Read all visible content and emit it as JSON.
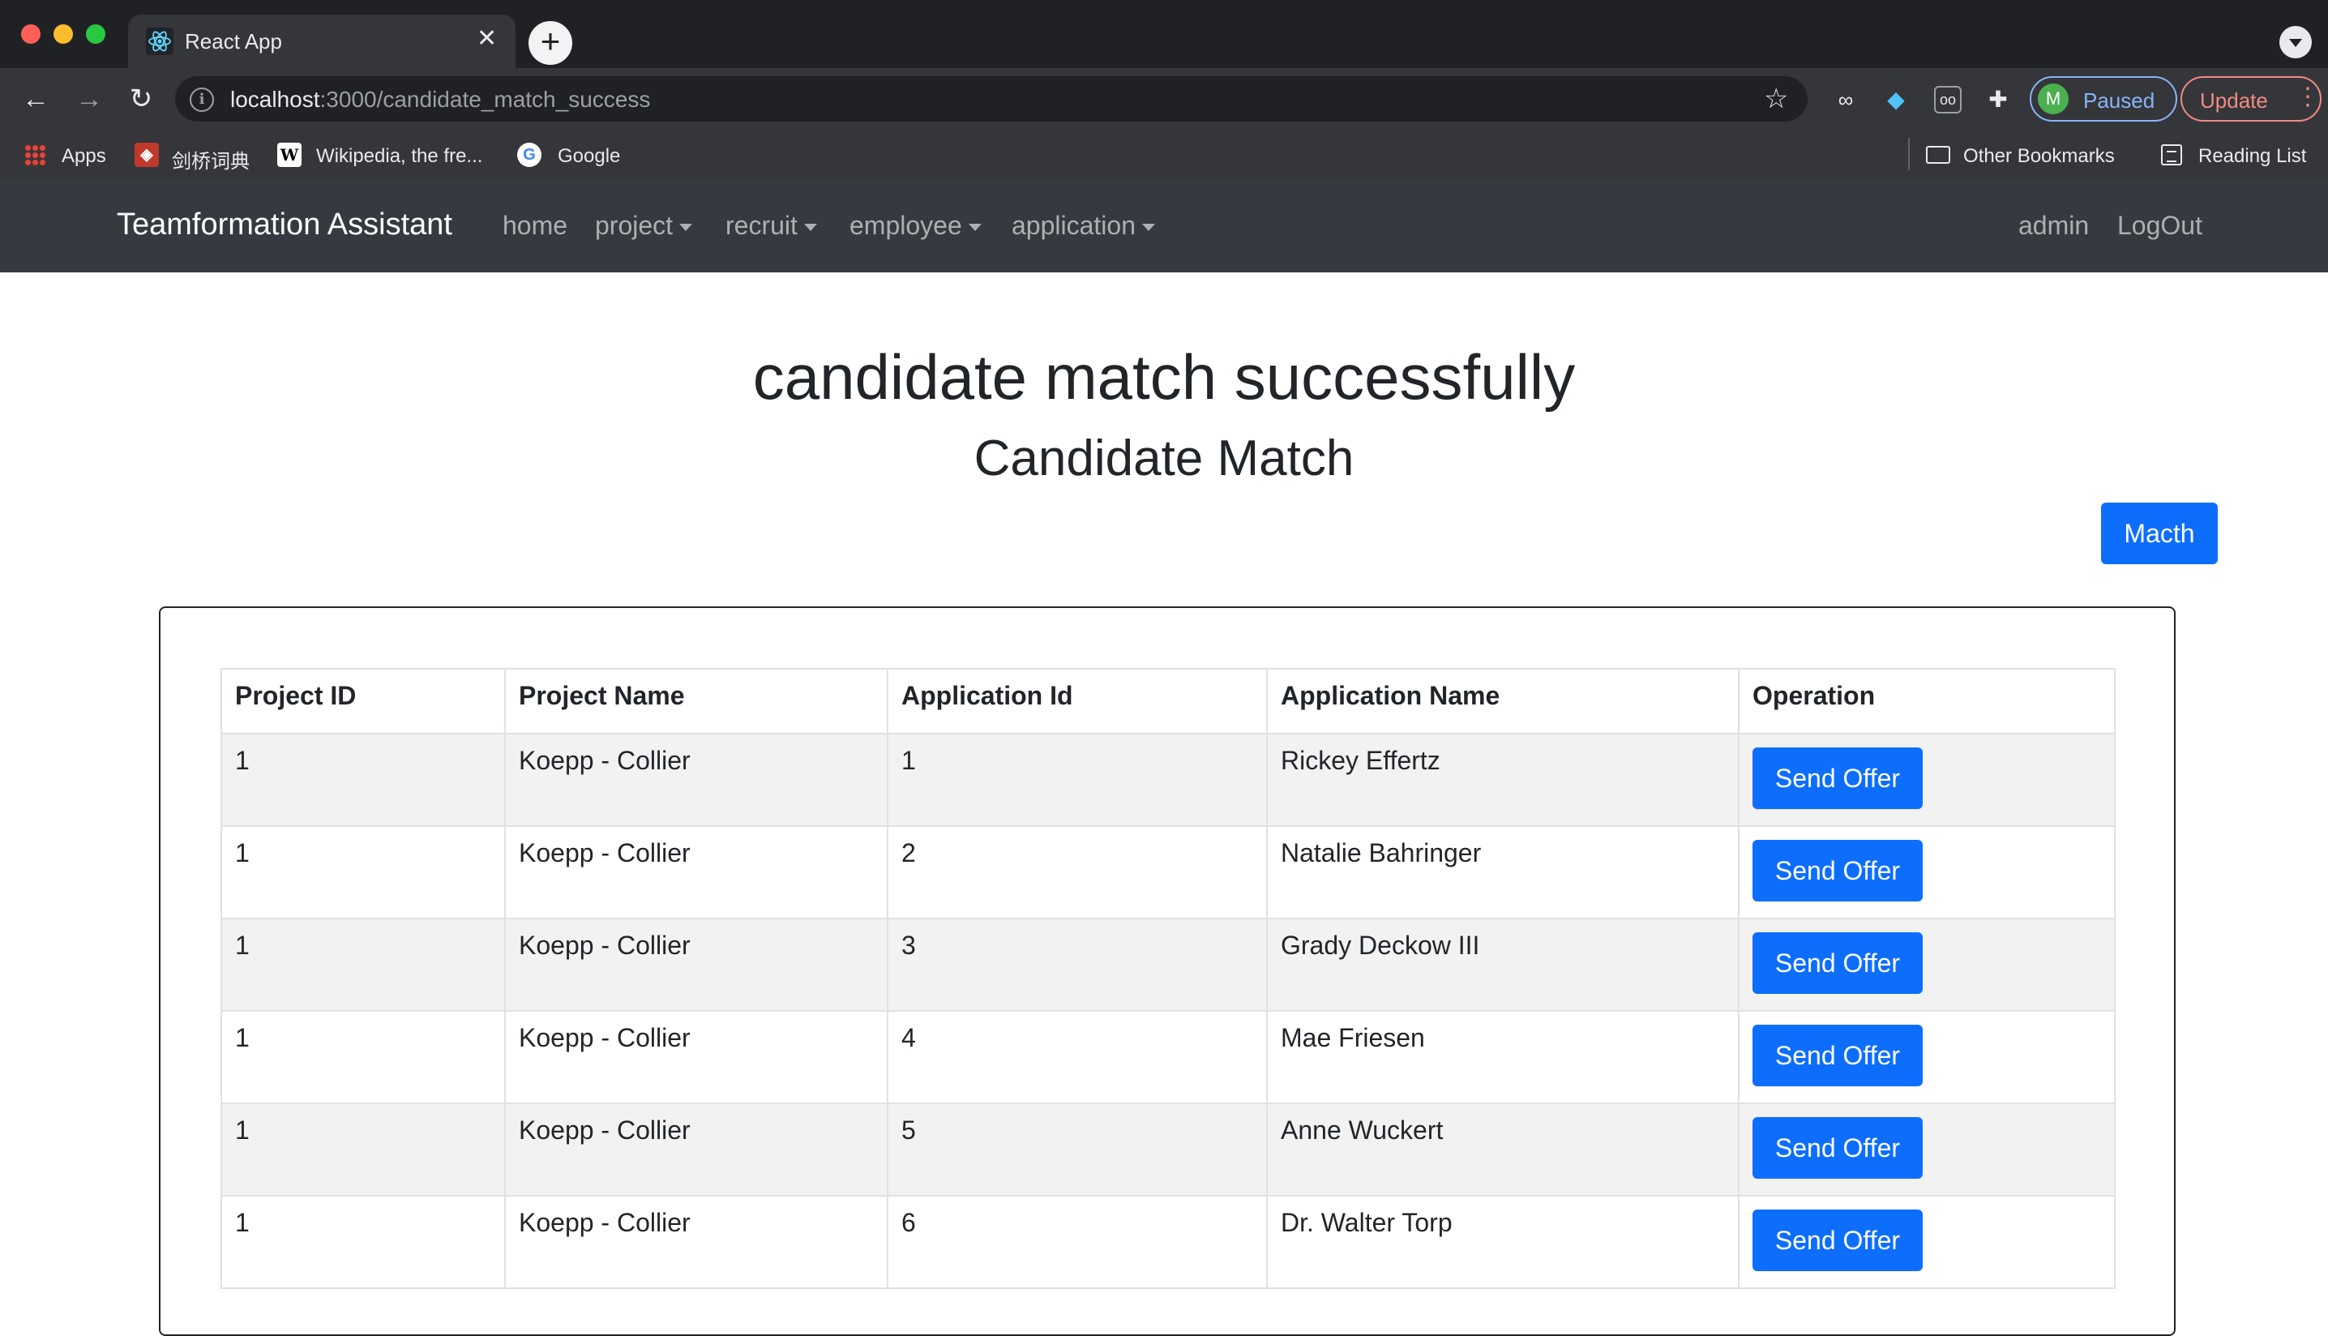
{
  "browser": {
    "tab_title": "React App",
    "url_host": "localhost",
    "url_path": ":3000/candidate_match_success",
    "profile_initial": "M",
    "profile_label": "Paused",
    "update_label": "Update",
    "bookmarks": [
      "Apps",
      "剑桥词典",
      "Wikipedia, the fre...",
      "Google"
    ],
    "bookmarks_right": [
      "Other Bookmarks",
      "Reading List"
    ]
  },
  "navbar": {
    "brand": "Teamformation Assistant",
    "links": [
      "home",
      "project",
      "recruit",
      "employee",
      "application"
    ],
    "right_links": [
      "admin",
      "LogOut"
    ]
  },
  "page": {
    "heading": "candidate match successfully",
    "subheading": "Candidate Match",
    "match_button": "Macth"
  },
  "table": {
    "headers": [
      "Project ID",
      "Project Name",
      "Application Id",
      "Application Name",
      "Operation"
    ],
    "rows": [
      {
        "project_id": "1",
        "project_name": "Koepp - Collier",
        "application_id": "1",
        "application_name": "Rickey Effertz",
        "operation": "Send Offer"
      },
      {
        "project_id": "1",
        "project_name": "Koepp - Collier",
        "application_id": "2",
        "application_name": "Natalie Bahringer",
        "operation": "Send Offer"
      },
      {
        "project_id": "1",
        "project_name": "Koepp - Collier",
        "application_id": "3",
        "application_name": "Grady Deckow III",
        "operation": "Send Offer"
      },
      {
        "project_id": "1",
        "project_name": "Koepp - Collier",
        "application_id": "4",
        "application_name": "Mae Friesen",
        "operation": "Send Offer"
      },
      {
        "project_id": "1",
        "project_name": "Koepp - Collier",
        "application_id": "5",
        "application_name": "Anne Wuckert",
        "operation": "Send Offer"
      },
      {
        "project_id": "1",
        "project_name": "Koepp - Collier",
        "application_id": "6",
        "application_name": "Dr. Walter Torp",
        "operation": "Send Offer"
      }
    ]
  },
  "colors": {
    "navbar_bg": "#343a40",
    "primary": "#0d6efd",
    "striped_row": "#f2f2f2"
  }
}
